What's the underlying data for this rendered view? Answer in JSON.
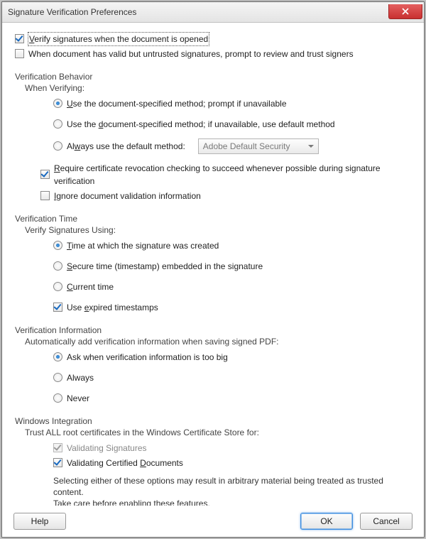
{
  "title": "Signature Verification Preferences",
  "top": {
    "verify_on_open": "Verify signatures when the document is opened",
    "prompt_untrusted": "When document has valid but untrusted signatures, prompt to review and trust signers"
  },
  "behavior": {
    "section": "Verification Behavior",
    "sub": "When Verifying:",
    "opt_prompt": "Use the document-specified method; prompt if unavailable",
    "opt_default": "Use the document-specified method; if unavailable, use default method",
    "opt_always": "Always use the default method:",
    "dropdown": "Adobe Default Security",
    "revocation": "Require certificate revocation checking to succeed whenever possible during signature verification",
    "ignore": "Ignore document validation information"
  },
  "time": {
    "section": "Verification Time",
    "sub": "Verify Signatures Using:",
    "opt_created": "Time at which the signature was created",
    "opt_secure": "Secure time (timestamp) embedded in the signature",
    "opt_current": "Current time",
    "expired": "Use expired timestamps"
  },
  "info": {
    "section": "Verification Information",
    "sub": "Automatically add verification information when saving signed PDF:",
    "opt_ask": "Ask when verification information is too big",
    "opt_always": "Always",
    "opt_never": "Never"
  },
  "win": {
    "section": "Windows Integration",
    "sub": "Trust ALL root certificates in the Windows Certificate Store for:",
    "sig": "Validating Signatures",
    "doc": "Validating Certified Documents",
    "note1": "Selecting either of these options may result in arbitrary material being treated as trusted content.",
    "note2": "Take care before enabling these features."
  },
  "buttons": {
    "help": "Help",
    "ok": "OK",
    "cancel": "Cancel"
  }
}
